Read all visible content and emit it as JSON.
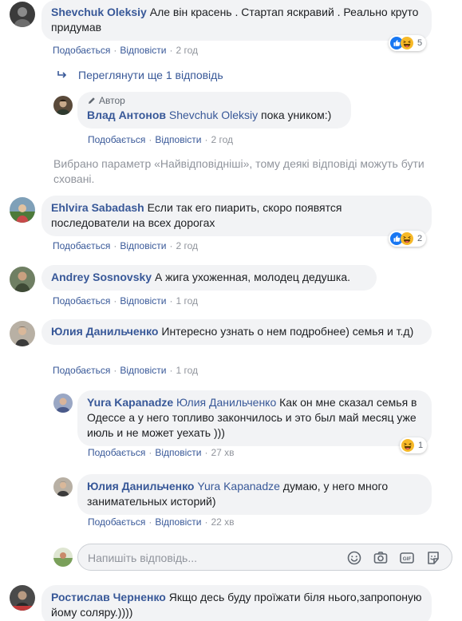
{
  "actions": {
    "like": "Подобається",
    "reply": "Відповісти",
    "sep": "·"
  },
  "comments": {
    "c1": {
      "author": "Shevchuk Oleksiy",
      "text": "Але він красень . Стартап яскравий . Реально круто придумав",
      "time": "2 год",
      "reactions": "5"
    },
    "view_more": "Переглянути ще 1 відповідь",
    "r1": {
      "badge": "Автор",
      "author": "Влад Антонов",
      "mention": "Shevchuk Oleksiy",
      "text": " пока уником:)",
      "time": "2 год"
    },
    "note": "Вибрано параметр «Найвідповідніші», тому деякі відповіді можуть бути сховані.",
    "c2": {
      "author": "Ehlvira Sabadash",
      "text": "Если так его пиарить, скоро появятся последователи на всех дорогах",
      "time": "2 год",
      "reactions": "2"
    },
    "c3": {
      "author": "Andrey Sosnovsky",
      "text": "А жига ухоженная, молодец дедушка.",
      "time": "1 год"
    },
    "c4": {
      "author": "Юлия Данильченко",
      "text": "Интересно узнать о нем подробнее) семья и т.д)",
      "time": "1 год"
    },
    "r2": {
      "author": "Yura Kapanadze",
      "mention": "Юлия Данильченко",
      "text": " Как он мне сказал семья в Одессе а у него топливо закончилось и это был май месяц уже июль и не может уехать )))",
      "time": "27 хв",
      "reactions": "1"
    },
    "r3": {
      "author": "Юлия Данильченко",
      "mention": "Yura Kapanadze",
      "text": " думаю, у него много занимательных историй)",
      "time": "22 хв"
    },
    "c5": {
      "author": "Ростислав Черненко",
      "text": "Якщо десь буду проїжати біля нього,запропоную йому соляру.))))"
    }
  },
  "reply_box": {
    "placeholder": "Напишіть відповідь..."
  },
  "colors": {
    "link": "#385898",
    "meta": "#90949c",
    "bubble": "#f2f3f5",
    "like_blue": "#1877f2",
    "haha_yellow": "#f7b928"
  },
  "icons": [
    "like-emoji-icon",
    "haha-emoji-icon",
    "reply-arrow-icon",
    "pencil-icon",
    "emoji-icon",
    "camera-icon",
    "gif-icon",
    "sticker-icon"
  ]
}
